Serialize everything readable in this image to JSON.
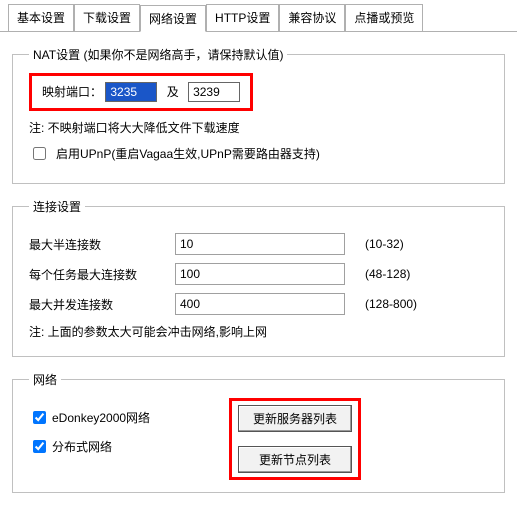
{
  "tabs": {
    "basic": "基本设置",
    "download": "下载设置",
    "network": "网络设置",
    "http": "HTTP设置",
    "compat": "兼容协议",
    "vod": "点播或预览"
  },
  "nat": {
    "legend": "NAT设置 (如果你不是网络高手，请保持默认值)",
    "port_label": "映射端口：",
    "port1": "3235",
    "and": "及",
    "port2": "3239",
    "note": "注: 不映射端口将大大降低文件下载速度",
    "upnp": "启用UPnP(重启Vagaa生效,UPnP需要路由器支持)"
  },
  "conn": {
    "legend": "连接设置",
    "half_label": "最大半连接数",
    "half_value": "10",
    "half_range": "(10-32)",
    "pertask_label": "每个任务最大连接数",
    "pertask_value": "100",
    "pertask_range": "(48-128)",
    "concurrent_label": "最大并发连接数",
    "concurrent_value": "400",
    "concurrent_range": "(128-800)",
    "note": "注: 上面的参数太大可能会冲击网络,影响上网"
  },
  "net": {
    "legend": "网络",
    "edonkey": "eDonkey2000网络",
    "distributed": "分布式网络",
    "update_servers": "更新服务器列表",
    "update_nodes": "更新节点列表"
  }
}
